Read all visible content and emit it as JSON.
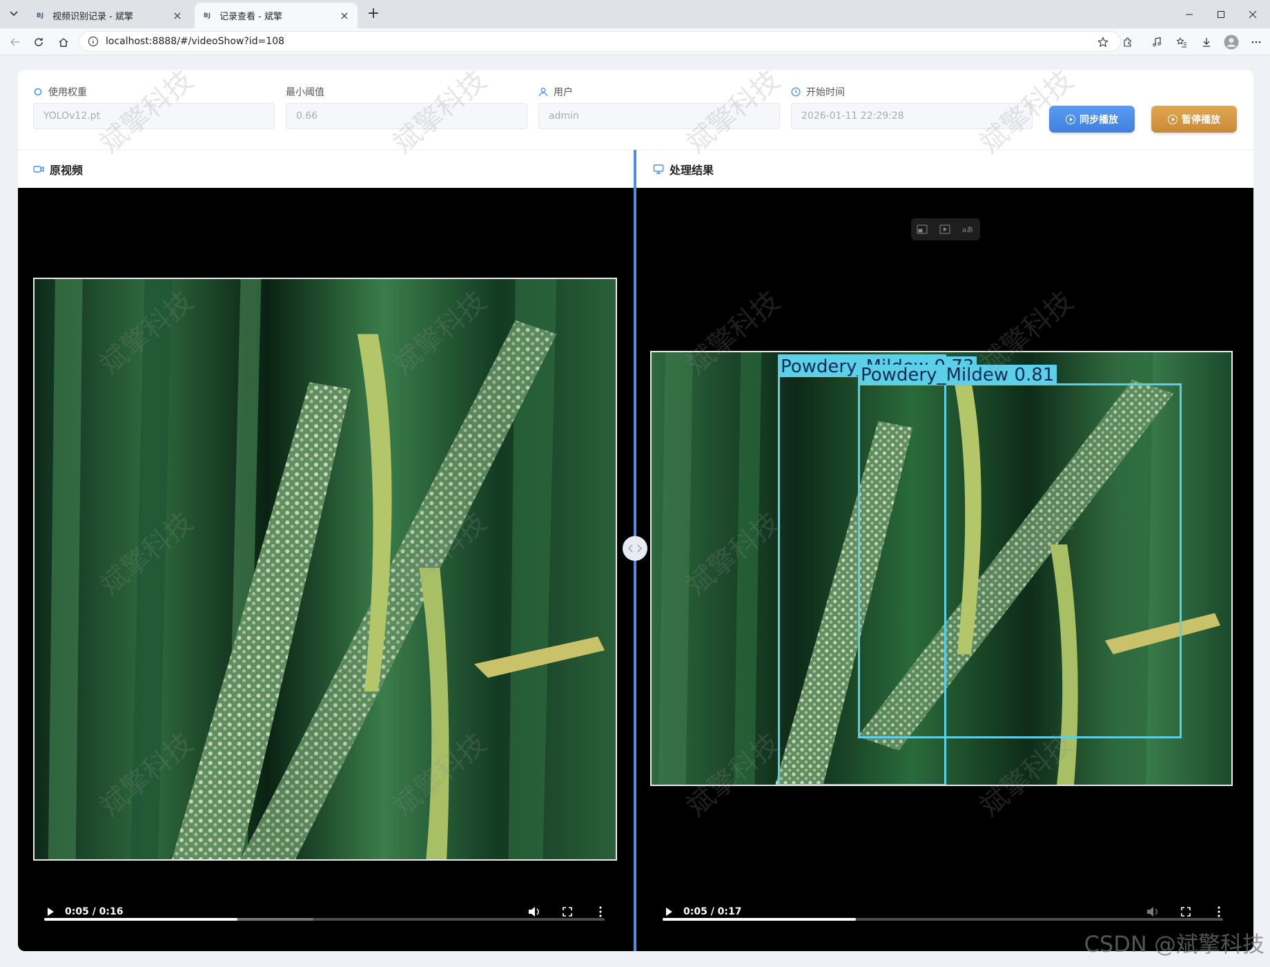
{
  "browser": {
    "tabs": [
      {
        "favicon": "BJ",
        "title": "视频识别记录 - 斌擎"
      },
      {
        "favicon": "BJ",
        "title": "记录查看 - 斌擎"
      }
    ],
    "url": "localhost:8888/#/videoShow?id=108"
  },
  "form": {
    "weight": {
      "label": "使用权重",
      "value": "YOLOv12.pt"
    },
    "threshold": {
      "label": "最小阈值",
      "value": "0.66"
    },
    "user": {
      "label": "用户",
      "value": "admin"
    },
    "start_time": {
      "label": "开始时间",
      "value": "2026-01-11 22:29:28"
    },
    "sync_button": "同步播放",
    "pause_button": "暂停播放"
  },
  "panels": {
    "original_title": "原视频",
    "result_title": "处理结果"
  },
  "videos": {
    "original": {
      "time": "0:05 / 0:16",
      "progress": 0.345,
      "buffered": 0.48
    },
    "result": {
      "time": "0:05 / 0:17",
      "progress": 0.345,
      "buffered": 0.345
    }
  },
  "detections": [
    {
      "label": "Powdery_Mildew 0.73"
    },
    {
      "label": "Powdery_Mildew  0.81"
    }
  ],
  "watermark": "斌擎科技",
  "credit": "CSDN @斌擎科技",
  "colors": {
    "accent": "#4a90e2",
    "sync_button": "#4a8be6",
    "pause_button": "#d69a44",
    "detection_box": "#5bd0e8"
  }
}
